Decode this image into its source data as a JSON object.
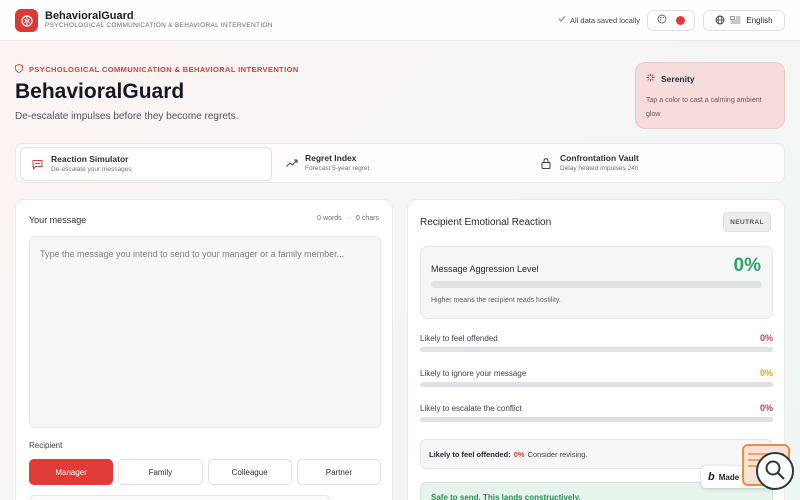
{
  "app": {
    "name": "BehavioralGuard",
    "subtitle": "PSYCHOLOGICAL COMMUNICATION & BEHAVIORAL INTERVENTION"
  },
  "header": {
    "saved_status": "All data saved locally",
    "language": "English",
    "accent_color": "#e03b37"
  },
  "hero": {
    "eyebrow": "PSYCHOLOGICAL COMMUNICATION & BEHAVIORAL INTERVENTION",
    "title": "BehavioralGuard",
    "subtitle": "De-escalate impulses before they become regrets."
  },
  "serenity": {
    "title": "Serenity",
    "text": "Tap a color to cast a calming ambient glow"
  },
  "tabs": [
    {
      "title": "Reaction Simulator",
      "subtitle": "De-escalate your messages",
      "icon": "message-icon",
      "active": true
    },
    {
      "title": "Regret Index",
      "subtitle": "Forecast 5-year regret",
      "icon": "trending-up-icon",
      "active": false
    },
    {
      "title": "Confrontation Vault",
      "subtitle": "Delay heated impulses 24h",
      "icon": "lock-icon",
      "active": false
    }
  ],
  "composer": {
    "label": "Your message",
    "words": "0 words",
    "separator": "·",
    "chars": "0 chars",
    "placeholder": "Type the message you intend to send to your manager or a family member...",
    "value": "",
    "recipient_label": "Recipient",
    "recipients": [
      "Manager",
      "Family",
      "Colleague",
      "Partner"
    ],
    "selected_recipient": "Manager"
  },
  "reaction": {
    "title": "Recipient Emotional Reaction",
    "badge": "NEUTRAL",
    "aggression": {
      "label": "Message Aggression Level",
      "value": "0%",
      "level": 0,
      "note": "Higher means the recipient reads hostility.",
      "color": "#2ea26a"
    },
    "metrics": [
      {
        "label": "Likely to feel offended",
        "value": "0%",
        "level": 0,
        "color": "#d4403c"
      },
      {
        "label": "Likely to ignore your message",
        "value": "0%",
        "level": 0,
        "color": "#e0a41c"
      },
      {
        "label": "Likely to escalate the conflict",
        "value": "0%",
        "level": 0,
        "color": "#c93a5e"
      }
    ],
    "summary": {
      "label": "Likely to feel offended:",
      "value": "0%",
      "advice": "Consider revising."
    },
    "safe_text": "Safe to send. This lands constructively."
  },
  "badge": {
    "made_in": "Made in B"
  }
}
